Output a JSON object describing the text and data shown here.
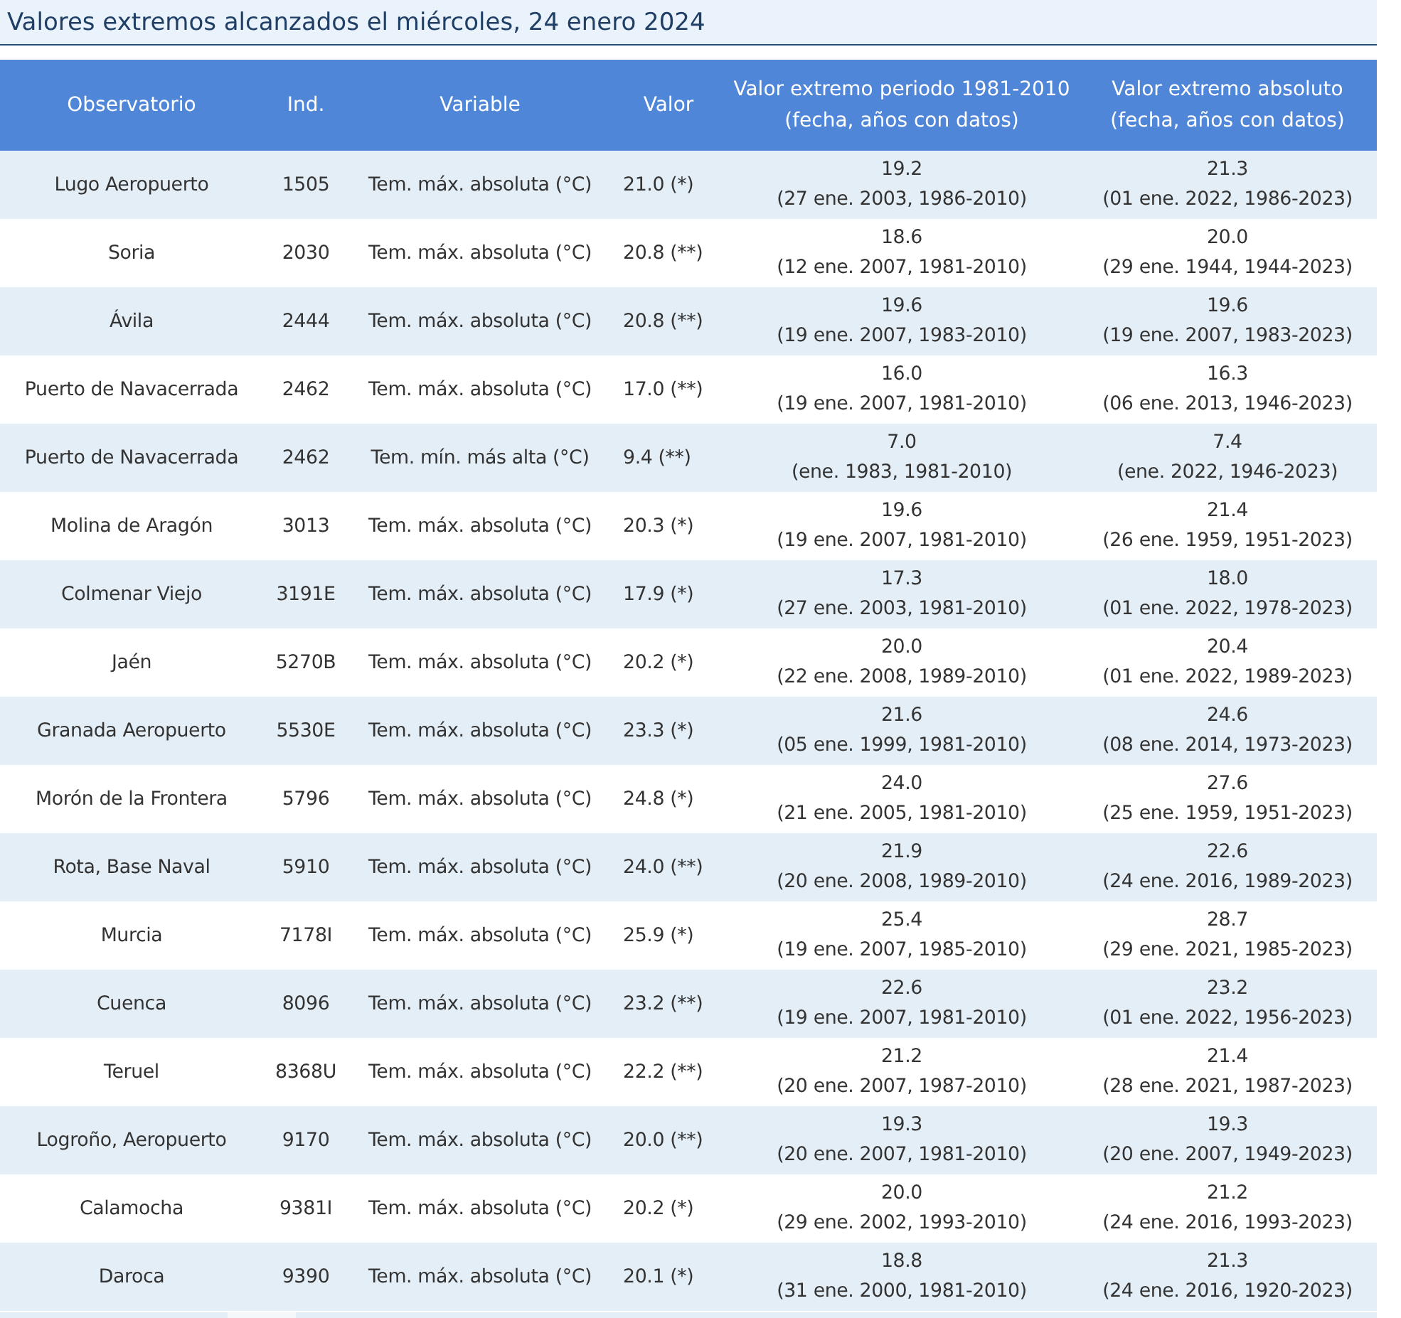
{
  "title": "Valores extremos alcanzados el miércoles, 24 enero 2024",
  "table": {
    "columns": [
      {
        "label": "Observatorio"
      },
      {
        "label": "Ind."
      },
      {
        "label": "Variable"
      },
      {
        "label": "Valor"
      },
      {
        "label": "Valor extremo periodo 1981-2010",
        "sublabel": "(fecha, años con datos)"
      },
      {
        "label": "Valor extremo absoluto",
        "sublabel": "(fecha, años con datos)"
      }
    ],
    "rows": [
      {
        "station": "Lugo Aeropuerto",
        "ind": "1505",
        "variable": "Tem. máx. absoluta (°C)",
        "value": "21.0 (*)",
        "period_value": "19.2",
        "period_detail": "(27 ene. 2003, 1986-2010)",
        "abs_value": "21.3",
        "abs_detail": "(01 ene. 2022, 1986-2023)"
      },
      {
        "station": "Soria",
        "ind": "2030",
        "variable": "Tem. máx. absoluta (°C)",
        "value": "20.8 (**)",
        "period_value": "18.6",
        "period_detail": "(12 ene. 2007, 1981-2010)",
        "abs_value": "20.0",
        "abs_detail": "(29 ene. 1944, 1944-2023)"
      },
      {
        "station": "Ávila",
        "ind": "2444",
        "variable": "Tem. máx. absoluta (°C)",
        "value": "20.8 (**)",
        "period_value": "19.6",
        "period_detail": "(19 ene. 2007, 1983-2010)",
        "abs_value": "19.6",
        "abs_detail": "(19 ene. 2007, 1983-2023)"
      },
      {
        "station": "Puerto de Navacerrada",
        "ind": "2462",
        "variable": "Tem. máx. absoluta (°C)",
        "value": "17.0 (**)",
        "period_value": "16.0",
        "period_detail": "(19 ene. 2007, 1981-2010)",
        "abs_value": "16.3",
        "abs_detail": "(06 ene. 2013, 1946-2023)"
      },
      {
        "station": "Puerto de Navacerrada",
        "ind": "2462",
        "variable": "Tem. mín. más alta (°C)",
        "value": "9.4 (**)",
        "period_value": "7.0",
        "period_detail": "(ene. 1983, 1981-2010)",
        "abs_value": "7.4",
        "abs_detail": "(ene. 2022, 1946-2023)"
      },
      {
        "station": "Molina de Aragón",
        "ind": "3013",
        "variable": "Tem. máx. absoluta (°C)",
        "value": "20.3 (*)",
        "period_value": "19.6",
        "period_detail": "(19 ene. 2007, 1981-2010)",
        "abs_value": "21.4",
        "abs_detail": "(26 ene. 1959, 1951-2023)"
      },
      {
        "station": "Colmenar Viejo",
        "ind": "3191E",
        "variable": "Tem. máx. absoluta (°C)",
        "value": "17.9 (*)",
        "period_value": "17.3",
        "period_detail": "(27 ene. 2003, 1981-2010)",
        "abs_value": "18.0",
        "abs_detail": "(01 ene. 2022, 1978-2023)"
      },
      {
        "station": "Jaén",
        "ind": "5270B",
        "variable": "Tem. máx. absoluta (°C)",
        "value": "20.2 (*)",
        "period_value": "20.0",
        "period_detail": "(22 ene. 2008, 1989-2010)",
        "abs_value": "20.4",
        "abs_detail": "(01 ene. 2022, 1989-2023)"
      },
      {
        "station": "Granada Aeropuerto",
        "ind": "5530E",
        "variable": "Tem. máx. absoluta (°C)",
        "value": "23.3 (*)",
        "period_value": "21.6",
        "period_detail": "(05 ene. 1999, 1981-2010)",
        "abs_value": "24.6",
        "abs_detail": "(08 ene. 2014, 1973-2023)"
      },
      {
        "station": "Morón de la Frontera",
        "ind": "5796",
        "variable": "Tem. máx. absoluta (°C)",
        "value": "24.8 (*)",
        "period_value": "24.0",
        "period_detail": "(21 ene. 2005, 1981-2010)",
        "abs_value": "27.6",
        "abs_detail": "(25 ene. 1959, 1951-2023)"
      },
      {
        "station": "Rota, Base Naval",
        "ind": "5910",
        "variable": "Tem. máx. absoluta (°C)",
        "value": "24.0 (**)",
        "period_value": "21.9",
        "period_detail": "(20 ene. 2008, 1989-2010)",
        "abs_value": "22.6",
        "abs_detail": "(24 ene. 2016, 1989-2023)"
      },
      {
        "station": "Murcia",
        "ind": "7178I",
        "variable": "Tem. máx. absoluta (°C)",
        "value": "25.9 (*)",
        "period_value": "25.4",
        "period_detail": "(19 ene. 2007, 1985-2010)",
        "abs_value": "28.7",
        "abs_detail": "(29 ene. 2021, 1985-2023)"
      },
      {
        "station": "Cuenca",
        "ind": "8096",
        "variable": "Tem. máx. absoluta (°C)",
        "value": "23.2 (**)",
        "period_value": "22.6",
        "period_detail": "(19 ene. 2007, 1981-2010)",
        "abs_value": "23.2",
        "abs_detail": "(01 ene. 2022, 1956-2023)"
      },
      {
        "station": "Teruel",
        "ind": "8368U",
        "variable": "Tem. máx. absoluta (°C)",
        "value": "22.2 (**)",
        "period_value": "21.2",
        "period_detail": "(20 ene. 2007, 1987-2010)",
        "abs_value": "21.4",
        "abs_detail": "(28 ene. 2021, 1987-2023)"
      },
      {
        "station": "Logroño, Aeropuerto",
        "ind": "9170",
        "variable": "Tem. máx. absoluta (°C)",
        "value": "20.0 (**)",
        "period_value": "19.3",
        "period_detail": "(20 ene. 2007, 1981-2010)",
        "abs_value": "19.3",
        "abs_detail": "(20 ene. 2007, 1949-2023)"
      },
      {
        "station": "Calamocha",
        "ind": "9381I",
        "variable": "Tem. máx. absoluta (°C)",
        "value": "20.2 (*)",
        "period_value": "20.0",
        "period_detail": "(29 ene. 2002, 1993-2010)",
        "abs_value": "21.2",
        "abs_detail": "(24 ene. 2016, 1993-2023)"
      },
      {
        "station": "Daroca",
        "ind": "9390",
        "variable": "Tem. máx. absoluta (°C)",
        "value": "20.1 (*)",
        "period_value": "18.8",
        "period_detail": "(31 ene. 2000, 1981-2010)",
        "abs_value": "21.3",
        "abs_detail": "(24 ene. 2016, 1920-2023)"
      }
    ]
  }
}
